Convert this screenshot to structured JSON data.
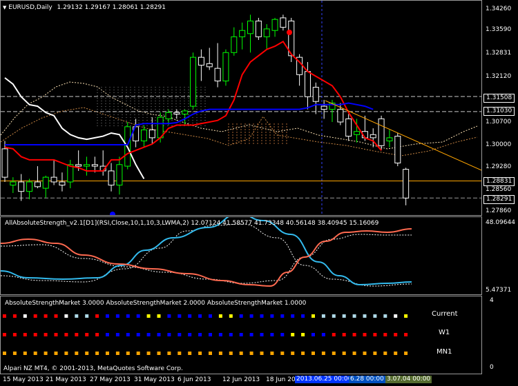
{
  "chart_title": "EURUSD,Daily",
  "ohlc_text": "1.29132 1.29167 1.28061 1.28291",
  "indicator1_caption": "AllAbsoluteStrength_v2.1[D1](RSI,Close,10,1,10,3,LWMA,2) 12.07124 41.58577 41.73348 40.56148 38.40945 15.16069",
  "indicator2_caption": "AbsoluteStrengthMarket 3.0000   AbsoluteStrengthMarket 2.0000   AbsoluteStrengthMarket 1.0000",
  "copyright": "Alpari NZ MT4, © 2001-2013, MetaQuotes Software Corp.",
  "row_labels": [
    "Current",
    "W1",
    "MN1"
  ],
  "price_axis": [
    "1.34260",
    "1.33590",
    "1.32831",
    "1.32120",
    "1.31508",
    "1.31030",
    "1.30700",
    "1.30000",
    "1.29280",
    "1.28831",
    "1.28560",
    "1.28291",
    "1.27860"
  ],
  "ind1_axis": {
    "max": "48.09644",
    "min": "5.47371"
  },
  "ind2_axis": {
    "max": "4",
    "min": "0"
  },
  "time_axis": [
    "15 May 2013",
    "21 May 2013",
    "27 May 2013",
    "31 May 2013",
    "6 Jun 2013",
    "12 Jun 2013",
    "18 Jun 20"
  ],
  "time_boxes": [
    "2013.06.25 00:00",
    "6.28 00:00",
    "3.07.04 00:00"
  ],
  "colors": {
    "bull": "#00ff00",
    "bear": "#ffffff",
    "tenkan": "#ffffff",
    "kijun": "#ff0000",
    "blueline": "#0000ff",
    "trend": "#ffa500",
    "cloud": "#ffe4b5"
  },
  "candles": [
    [
      1.2985,
      1.301,
      1.288,
      1.2895
    ],
    [
      1.287,
      1.2895,
      1.2845,
      1.288
    ],
    [
      1.288,
      1.2905,
      1.282,
      1.285
    ],
    [
      1.285,
      1.289,
      1.2825,
      1.288
    ],
    [
      1.288,
      1.293,
      1.286,
      1.2865
    ],
    [
      1.286,
      1.29,
      1.283,
      1.2895
    ],
    [
      1.2895,
      1.295,
      1.287,
      1.288
    ],
    [
      1.288,
      1.291,
      1.285,
      1.287
    ],
    [
      1.288,
      1.295,
      1.286,
      1.2935
    ],
    [
      1.2935,
      1.298,
      1.2915,
      1.293
    ],
    [
      1.293,
      1.296,
      1.29,
      1.2935
    ],
    [
      1.2935,
      1.296,
      1.291,
      1.293
    ],
    [
      1.293,
      1.298,
      1.29,
      1.2915
    ],
    [
      1.2915,
      1.294,
      1.285,
      1.287
    ],
    [
      1.287,
      1.296,
      1.284,
      1.2935
    ],
    [
      1.293,
      1.307,
      1.292,
      1.3055
    ],
    [
      1.3055,
      1.308,
      1.299,
      1.301
    ],
    [
      1.301,
      1.306,
      1.299,
      1.3045
    ],
    [
      1.3045,
      1.3085,
      1.3,
      1.302
    ],
    [
      1.302,
      1.31,
      1.3005,
      1.3085
    ],
    [
      1.308,
      1.311,
      1.306,
      1.31
    ],
    [
      1.31,
      1.311,
      1.308,
      1.3095
    ],
    [
      1.3095,
      1.311,
      1.306,
      1.3105
    ],
    [
      1.312,
      1.329,
      1.311,
      1.3275
    ],
    [
      1.3275,
      1.33,
      1.32,
      1.325
    ],
    [
      1.3255,
      1.3305,
      1.3235,
      1.3245
    ],
    [
      1.324,
      1.332,
      1.318,
      1.32
    ],
    [
      1.32,
      1.33,
      1.3185,
      1.329
    ],
    [
      1.329,
      1.337,
      1.328,
      1.334
    ],
    [
      1.334,
      1.3385,
      1.33,
      1.336
    ],
    [
      1.335,
      1.341,
      1.329,
      1.339
    ],
    [
      1.339,
      1.34,
      1.333,
      1.334
    ],
    [
      1.334,
      1.338,
      1.33,
      1.3365
    ],
    [
      1.336,
      1.34,
      1.334,
      1.3395
    ],
    [
      1.34,
      1.341,
      1.336,
      1.337
    ],
    [
      1.339,
      1.34,
      1.326,
      1.328
    ],
    [
      1.3275,
      1.3285,
      1.3185,
      1.322
    ],
    [
      1.323,
      1.326,
      1.311,
      1.315
    ],
    [
      1.318,
      1.3195,
      1.3095,
      1.3135
    ],
    [
      1.312,
      1.314,
      1.308,
      1.311
    ],
    [
      1.311,
      1.314,
      1.307,
      1.313
    ],
    [
      1.311,
      1.313,
      1.306,
      1.307
    ],
    [
      1.308,
      1.3095,
      1.301,
      1.3025
    ],
    [
      1.303,
      1.308,
      1.3005,
      1.304
    ],
    [
      1.304,
      1.309,
      1.301,
      1.302
    ],
    [
      1.303,
      1.305,
      1.299,
      1.302
    ],
    [
      1.308,
      1.309,
      1.298,
      1.2995
    ],
    [
      1.301,
      1.3045,
      1.299,
      1.302
    ],
    [
      1.3025,
      1.3035,
      1.293,
      1.294
    ],
    [
      1.292,
      1.2925,
      1.2806,
      1.2829
    ]
  ],
  "tenkan": [
    1.321,
    1.319,
    1.315,
    1.3125,
    1.312,
    1.31,
    1.309,
    1.305,
    1.303,
    1.302,
    1.3015,
    1.302,
    1.3025,
    1.3035,
    1.303,
    1.299,
    1.2935,
    1.289
  ],
  "kijun": [
    1.299,
    1.2985,
    1.296,
    1.295,
    1.295,
    1.295,
    1.295,
    1.294,
    1.293,
    1.2925,
    1.2915,
    1.2915,
    1.2915,
    1.295,
    1.295,
    1.297,
    1.298,
    1.299,
    1.3,
    1.302,
    1.305,
    1.306,
    1.306,
    1.306,
    1.3065,
    1.307,
    1.3075,
    1.309,
    1.314,
    1.322,
    1.326,
    1.328,
    1.33,
    1.331,
    1.3325,
    1.3285,
    1.326,
    1.323,
    1.3215,
    1.32,
    1.3185,
    1.315,
    1.31,
    1.306,
    1.302,
    1.301,
    1.298
  ],
  "blueline": [
    1.2998,
    1.2998,
    1.2998,
    1.2998,
    1.2998,
    1.2998,
    1.2998,
    1.2998,
    1.2998,
    1.2998,
    1.2998,
    1.2998,
    1.2998,
    1.2998,
    1.2998,
    1.2998,
    1.306,
    1.3065,
    1.3065,
    1.3065,
    1.3065,
    1.3068,
    1.308,
    1.3095,
    1.3105,
    1.311,
    1.311,
    1.311,
    1.311,
    1.311,
    1.311,
    1.311,
    1.311,
    1.311,
    1.311,
    1.311,
    1.311,
    1.3115,
    1.3125,
    1.3125,
    1.3125,
    1.3125,
    1.313,
    1.3125,
    1.312,
    1.311
  ]
}
